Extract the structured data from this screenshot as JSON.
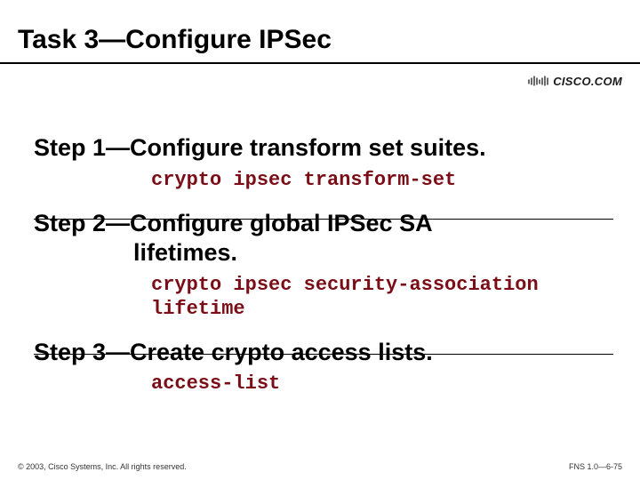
{
  "title": "Task 3—Configure IPSec",
  "logo_text": "CISCO.COM",
  "steps": [
    {
      "heading": "Step 1—Configure transform set suites.",
      "heading_line2": "",
      "command": "crypto ipsec transform-set"
    },
    {
      "heading": "Step 2—Configure global IPSec SA",
      "heading_line2": "lifetimes.",
      "command": "crypto ipsec security-association\nlifetime"
    },
    {
      "heading": "Step 3—Create crypto access lists.",
      "heading_line2": "",
      "command": "access-list"
    }
  ],
  "footer": {
    "left": "© 2003, Cisco Systems, Inc. All rights reserved.",
    "right": "FNS 1.0—6-75"
  }
}
